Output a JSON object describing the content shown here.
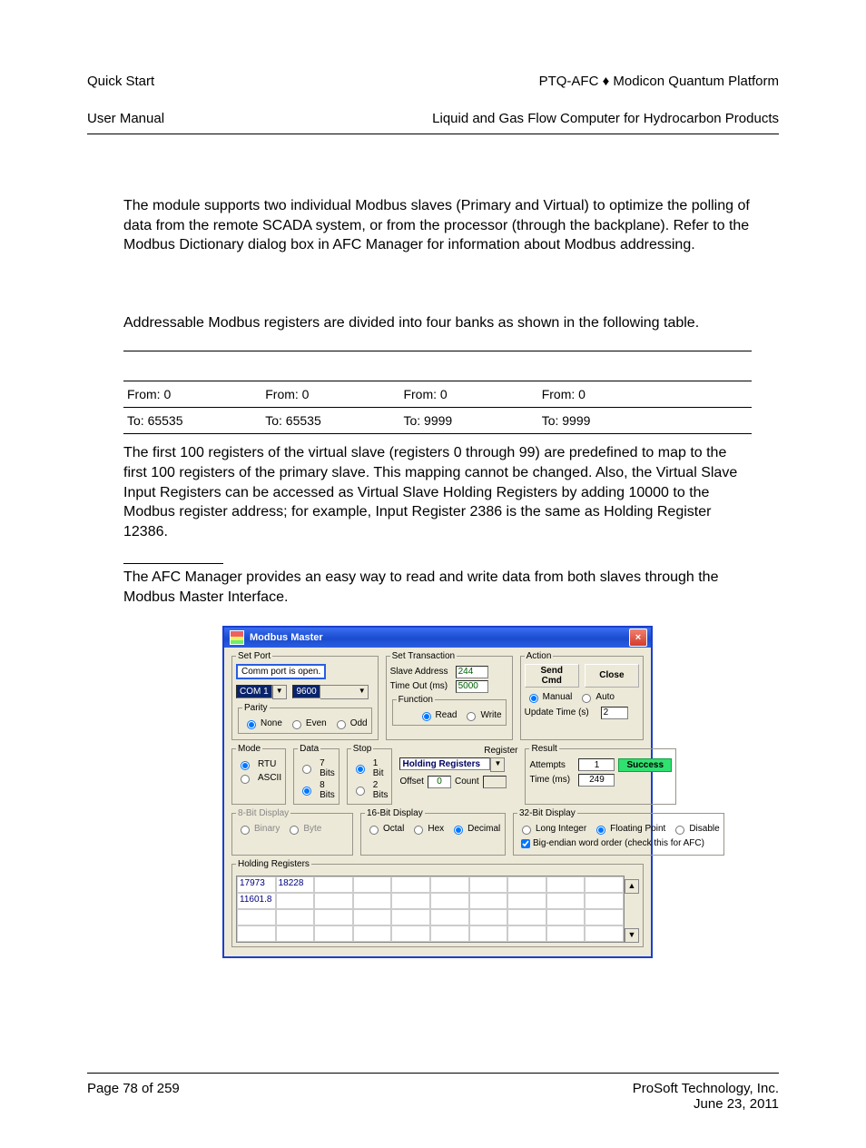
{
  "header": {
    "left_line1": "Quick Start",
    "left_line2": "User Manual",
    "right_line1": "PTQ-AFC ♦ Modicon Quantum Platform",
    "right_line2": "Liquid and Gas Flow Computer for Hydrocarbon Products"
  },
  "paragraphs": {
    "p1": "The module supports two individual Modbus slaves (Primary and Virtual) to optimize the polling of data from the remote SCADA system, or from the processor (through the backplane). Refer to the Modbus Dictionary dialog box in AFC Manager for information about Modbus addressing.",
    "p2": "Addressable Modbus registers are divided into four banks as shown in the following table.",
    "p3": "The first 100 registers of the virtual slave (registers 0 through 99) are predefined to map to the first 100 registers of the primary slave. This mapping cannot be changed. Also, the Virtual Slave Input Registers can be accessed as Virtual Slave Holding Registers by adding 10000 to the Modbus register address; for example, Input Register 2386 is the same as Holding Register 12386.",
    "p4": "The AFC Manager provides an easy way to read and write data from both slaves through the Modbus Master Interface."
  },
  "table": {
    "rows": [
      [
        "From: 0",
        "From: 0",
        "From: 0",
        "From: 0",
        ""
      ],
      [
        "To: 65535",
        "To: 65535",
        "To: 9999",
        "To: 9999",
        ""
      ]
    ]
  },
  "dialog": {
    "title": "Modbus Master",
    "close": "×",
    "set_port": {
      "legend": "Set Port",
      "status": "Comm port is open.",
      "port": "COM 1",
      "baud": "9600",
      "parity": {
        "legend": "Parity",
        "none": "None",
        "even": "Even",
        "odd": "Odd",
        "selected": "none"
      },
      "mode": {
        "legend": "Mode",
        "rtu": "RTU",
        "ascii": "ASCII",
        "selected": "rtu"
      },
      "data": {
        "legend": "Data",
        "b7": "7 Bits",
        "b8": "8 Bits",
        "selected": "b8"
      },
      "stop": {
        "legend": "Stop",
        "b1": "1 Bit",
        "b2": "2 Bits",
        "selected": "b1"
      }
    },
    "set_txn": {
      "legend": "Set Transaction",
      "slave_lbl": "Slave Address",
      "slave_val": "244",
      "timeout_lbl": "Time Out (ms)",
      "timeout_val": "5000",
      "function": {
        "legend": "Function",
        "read": "Read",
        "write": "Write",
        "selected": "read"
      },
      "register_lbl": "Register",
      "holding": "Holding Registers",
      "offset_lbl": "Offset",
      "offset_val": "0",
      "count_lbl": "Count"
    },
    "action": {
      "legend": "Action",
      "send": "Send Cmd",
      "close": "Close",
      "manual": "Manual",
      "auto": "Auto",
      "selected": "manual",
      "update_lbl": "Update Time (s)",
      "update_val": "2"
    },
    "result": {
      "legend": "Result",
      "attempts_lbl": "Attempts",
      "attempts_val": "1",
      "time_lbl": "Time (ms)",
      "time_val": "249",
      "status": "Success"
    },
    "display": {
      "d8": {
        "legend": "8-Bit Display",
        "binary": "Binary",
        "byte": "Byte"
      },
      "d16": {
        "legend": "16-Bit Display",
        "octal": "Octal",
        "hex": "Hex",
        "decimal": "Decimal",
        "selected": "decimal"
      },
      "d32": {
        "legend": "32-Bit Display",
        "long": "Long Integer",
        "float": "Floating Point",
        "disable": "Disable",
        "selected": "float",
        "big_endian": "Big-endian word order (check this for AFC)",
        "big_endian_checked": true
      }
    },
    "registers": {
      "legend": "Holding Registers",
      "cells": [
        "17973",
        "18228",
        "",
        "",
        "",
        "",
        "",
        "",
        "",
        "",
        "11601.8",
        "",
        "",
        "",
        "",
        "",
        "",
        "",
        "",
        ""
      ]
    }
  },
  "footer": {
    "left": "Page 78 of 259",
    "right_line1": "ProSoft Technology, Inc.",
    "right_line2": "June 23, 2011"
  }
}
